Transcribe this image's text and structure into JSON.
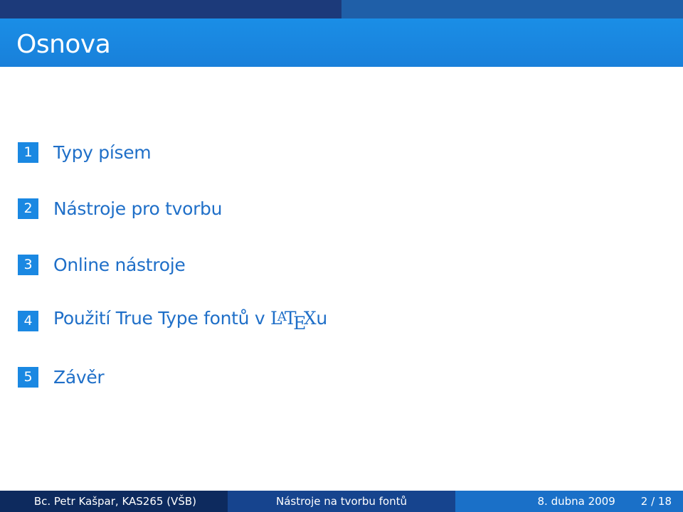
{
  "frame": {
    "title": "Osnova"
  },
  "toc": [
    {
      "number": "1",
      "label": "Typy písem"
    },
    {
      "number": "2",
      "label": "Nástroje pro tvorbu"
    },
    {
      "number": "3",
      "label": "Online nástroje"
    },
    {
      "number": "4",
      "label_prefix": "Použití True Type fontů v ",
      "logo": "LaTeX",
      "label_suffix": "u"
    },
    {
      "number": "5",
      "label": "Závěr"
    }
  ],
  "footer": {
    "author": "Bc. Petr Kašpar, KAS265 (VŠB)",
    "title": "Nástroje na tvorbu fontů",
    "date": "8. dubna 2009",
    "page": "2 / 18"
  },
  "colors": {
    "title_bar": "#1a8ee6",
    "accent_text": "#1f6fc8",
    "number_box": "#1a88e2",
    "footer_dark": "#0d2a5e",
    "footer_mid": "#16448e",
    "footer_light": "#1a70c8"
  }
}
